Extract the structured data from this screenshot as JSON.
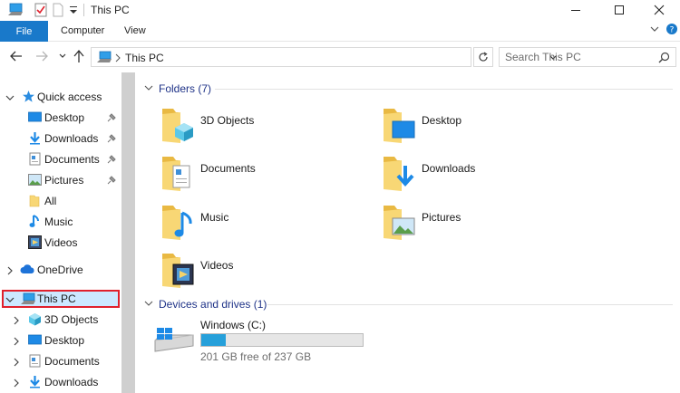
{
  "window": {
    "title": "This PC",
    "colors": {
      "accent": "#1979ca",
      "selection": "#cce8ff",
      "highlight_border": "#e0202c",
      "drive_fill": "#26a0da"
    }
  },
  "ribbon": {
    "tabs": [
      "File",
      "Computer",
      "View"
    ]
  },
  "address": {
    "path": "This PC",
    "search_placeholder": "Search This PC"
  },
  "nav_pane": {
    "quick_access": {
      "label": "Quick access",
      "items": [
        {
          "label": "Desktop",
          "icon": "desktop-icon",
          "pinned": true
        },
        {
          "label": "Downloads",
          "icon": "downloads-icon",
          "pinned": true
        },
        {
          "label": "Documents",
          "icon": "documents-icon",
          "pinned": true
        },
        {
          "label": "Pictures",
          "icon": "pictures-icon",
          "pinned": true
        },
        {
          "label": "All",
          "icon": "folder-icon",
          "pinned": false
        },
        {
          "label": "Music",
          "icon": "music-icon",
          "pinned": false
        },
        {
          "label": "Videos",
          "icon": "videos-icon",
          "pinned": false
        }
      ]
    },
    "onedrive": {
      "label": "OneDrive"
    },
    "this_pc": {
      "label": "This PC",
      "children": [
        {
          "label": "3D Objects",
          "icon": "3d-objects-icon"
        },
        {
          "label": "Desktop",
          "icon": "desktop-icon"
        },
        {
          "label": "Documents",
          "icon": "documents-icon"
        },
        {
          "label": "Downloads",
          "icon": "downloads-icon"
        }
      ]
    }
  },
  "content": {
    "folders_header": "Folders (7)",
    "folders": [
      {
        "label": "3D Objects",
        "icon": "3d-objects-folder-icon"
      },
      {
        "label": "Desktop",
        "icon": "desktop-folder-icon"
      },
      {
        "label": "Documents",
        "icon": "documents-folder-icon"
      },
      {
        "label": "Downloads",
        "icon": "downloads-folder-icon"
      },
      {
        "label": "Music",
        "icon": "music-folder-icon"
      },
      {
        "label": "Pictures",
        "icon": "pictures-folder-icon"
      },
      {
        "label": "Videos",
        "icon": "videos-folder-icon"
      }
    ],
    "devices_header": "Devices and drives (1)",
    "drives": [
      {
        "name": "Windows (C:)",
        "free_text": "201 GB free of 237 GB",
        "used_fraction": 0.152
      }
    ]
  }
}
